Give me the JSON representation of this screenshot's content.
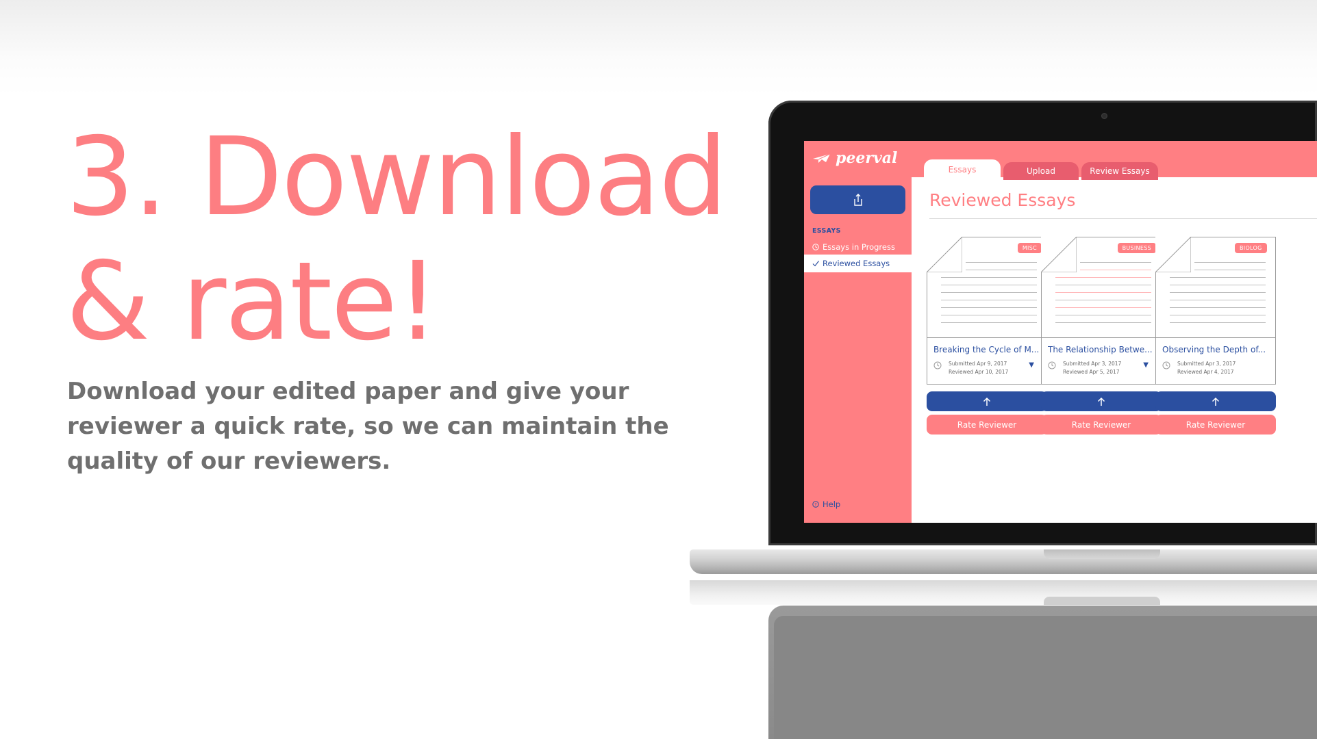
{
  "hero": {
    "headline_line1": "3. Download",
    "headline_line2": "& rate!",
    "description": "Download your edited paper and give your reviewer a quick rate, so we can maintain the quality of our reviewers."
  },
  "app": {
    "logo_text": "peerval",
    "colors": {
      "brand_pink": "#ff7f83",
      "brand_blue": "#2b4fa0",
      "tab_inactive": "#e85d6e"
    },
    "sidebar": {
      "upload_icon": "upload-icon",
      "section_label": "ESSAYS",
      "items": [
        {
          "label": "Essays in Progress",
          "icon": "clock-icon",
          "active": false
        },
        {
          "label": "Reviewed Essays",
          "icon": "check-icon",
          "active": true
        }
      ],
      "help_label": "Help"
    },
    "tabs": [
      {
        "label": "Essays",
        "active": true
      },
      {
        "label": "Upload",
        "active": false
      },
      {
        "label": "Review Essays",
        "active": false
      }
    ],
    "main": {
      "title": "Reviewed Essays",
      "essays": [
        {
          "category": "MISC",
          "title": "Breaking the Cycle of M...",
          "submitted": "Submitted Apr 9, 2017",
          "reviewed": "Reviewed Apr 10, 2017",
          "download_icon": "arrow-up-icon",
          "rate_label": "Rate Reviewer"
        },
        {
          "category": "BUSINESS",
          "title": "The Relationship Betwe...",
          "submitted": "Submitted Apr 3, 2017",
          "reviewed": "Reviewed Apr 5, 2017",
          "download_icon": "arrow-up-icon",
          "rate_label": "Rate Reviewer"
        },
        {
          "category": "BIOLOG",
          "title": "Observing the Depth of...",
          "submitted": "Submitted Apr 3, 2017",
          "reviewed": "Reviewed Apr 4, 2017",
          "download_icon": "arrow-up-icon",
          "rate_label": "Rate Reviewer"
        }
      ]
    }
  }
}
